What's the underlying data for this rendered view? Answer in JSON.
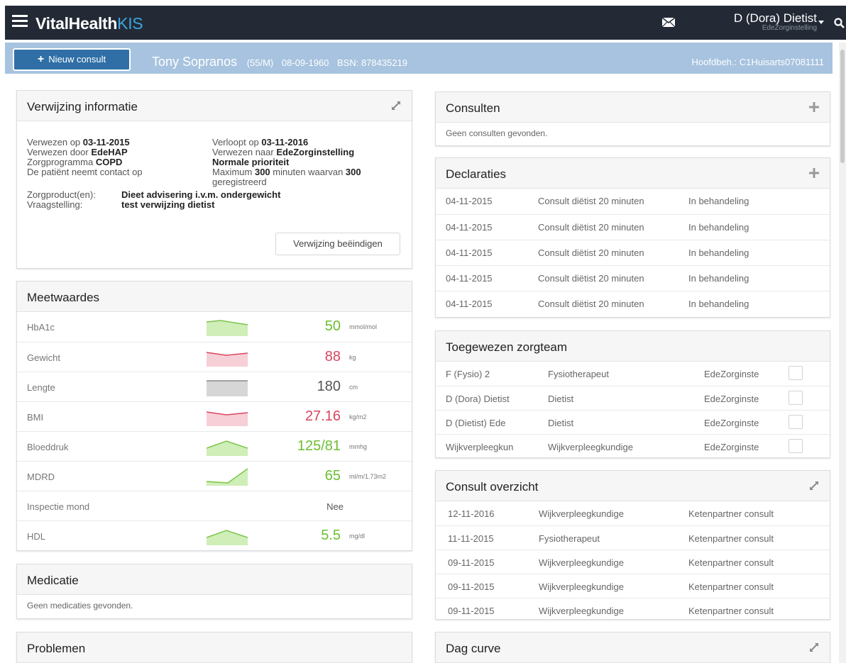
{
  "topbar": {
    "brand_main": "VitalHealth",
    "brand_accent": "KIS",
    "user_name": "D (Dora) Dietist",
    "user_org": "EdeZorginstelling",
    "icons": [
      "menu-icon",
      "mail-icon",
      "chevron-down-icon",
      "search-icon"
    ]
  },
  "patient": {
    "new_consult_label": "Nieuw consult",
    "name": "Tony Sopranos",
    "age_sex": "(55/M)",
    "dob": "08-09-1960",
    "bsn": "BSN: 878435219",
    "hoofdbehandelaar": "Hoofdbeh.: C1Huisarts07081111"
  },
  "verwijzing": {
    "title": "Verwijzing informatie",
    "verwezen_op_label": "Verwezen op",
    "verwezen_op_value": "03-11-2015",
    "verwezen_door_label": "Verwezen door",
    "verwezen_door_value": "EdeHAP",
    "zorgprogramma_label": "Zorgprogramma",
    "zorgprogramma_value": "COPD",
    "contact_text": "De patiënt neemt contact op",
    "verloopt_op_label": "Verloopt op",
    "verloopt_op_value": "03-11-2016",
    "verwezen_naar_label": "Verwezen naar",
    "verwezen_naar_value": "EdeZorginstelling",
    "prioriteit": "Normale prioriteit",
    "maximum_1": "Maximum",
    "maximum_value": "300",
    "maximum_2": "minuten waarvan",
    "maximum_reg_value": "300",
    "maximum_3": "geregistreerd",
    "zorgproduct_label": "Zorgproduct(en):",
    "zorgproduct_value": "Dieet advisering i.v.m. ondergewicht",
    "vraagstelling_label": "Vraagstelling:",
    "vraagstelling_value": "test verwijzing dietist",
    "stop_button": "Verwijzing beëindigen"
  },
  "meetwaardes": {
    "title": "Meetwaardes",
    "rows": [
      {
        "label": "HbA1c",
        "value": "50",
        "unit": "mmol/mol",
        "status": "green",
        "trend": "flat-up"
      },
      {
        "label": "Gewicht",
        "value": "88",
        "unit": "kg",
        "status": "red",
        "trend": "dip"
      },
      {
        "label": "Lengte",
        "value": "180",
        "unit": "cm",
        "status": "gray",
        "trend": "flat"
      },
      {
        "label": "BMI",
        "value": "27.16",
        "unit": "kg/m2",
        "status": "red",
        "trend": "dip"
      },
      {
        "label": "Bloeddruk",
        "value": "125/81",
        "unit": "mmhg",
        "status": "green",
        "trend": "peak"
      },
      {
        "label": "MDRD",
        "value": "65",
        "unit": "ml/m/1.73m2",
        "status": "green",
        "trend": "rise"
      },
      {
        "label": "Inspectie mond",
        "value": "Nee",
        "unit": "",
        "status": "gray",
        "trend": "none"
      },
      {
        "label": "HDL",
        "value": "5.5",
        "unit": "mg/dl",
        "status": "green",
        "trend": "peak"
      }
    ]
  },
  "medicatie": {
    "title": "Medicatie",
    "empty": "Geen medicaties gevonden."
  },
  "problemen": {
    "title": "Problemen"
  },
  "consulten": {
    "title": "Consulten",
    "empty": "Geen consulten gevonden."
  },
  "declaraties": {
    "title": "Declaraties",
    "rows": [
      {
        "date": "04-11-2015",
        "desc": "Consult diëtist 20 minuten",
        "status": "In behandeling"
      },
      {
        "date": "04-11-2015",
        "desc": "Consult diëtist 20 minuten",
        "status": "In behandeling"
      },
      {
        "date": "04-11-2015",
        "desc": "Consult diëtist 20 minuten",
        "status": "In behandeling"
      },
      {
        "date": "04-11-2015",
        "desc": "Consult diëtist 20 minuten",
        "status": "In behandeling"
      },
      {
        "date": "04-11-2015",
        "desc": "Consult diëtist 20 minuten",
        "status": "In behandeling"
      }
    ]
  },
  "zorgteam": {
    "title": "Toegewezen zorgteam",
    "rows": [
      {
        "name": "F (Fysio) 2",
        "role": "Fysiotherapeut",
        "org": "EdeZorginste"
      },
      {
        "name": "D (Dora) Dietist",
        "role": "Dietist",
        "org": "EdeZorginste"
      },
      {
        "name": "D (Dietist) Ede",
        "role": "Dietist",
        "org": "EdeZorginste"
      },
      {
        "name": "Wijkverpleegkun",
        "role": "Wijkverpleegkundige",
        "org": "EdeZorginste"
      }
    ]
  },
  "consult_overzicht": {
    "title": "Consult overzicht",
    "rows": [
      {
        "date": "12-11-2016",
        "role": "Wijkverpleegkundige",
        "type": "Ketenpartner consult"
      },
      {
        "date": "11-11-2015",
        "role": "Fysiotherapeut",
        "type": "Ketenpartner consult"
      },
      {
        "date": "09-11-2015",
        "role": "Wijkverpleegkundige",
        "type": "Ketenpartner consult"
      },
      {
        "date": "09-11-2015",
        "role": "Wijkverpleegkundige",
        "type": "Ketenpartner consult"
      },
      {
        "date": "09-11-2015",
        "role": "Wijkverpleegkundige",
        "type": "Ketenpartner consult"
      }
    ]
  },
  "dag_curve": {
    "title": "Dag curve"
  },
  "colors": {
    "topbar": "#232a36",
    "accent": "#3aa6e0",
    "patientbar": "#a7c3df",
    "button": "#2f6fa6",
    "good": "#6bbf2f",
    "bad": "#d9455f"
  }
}
